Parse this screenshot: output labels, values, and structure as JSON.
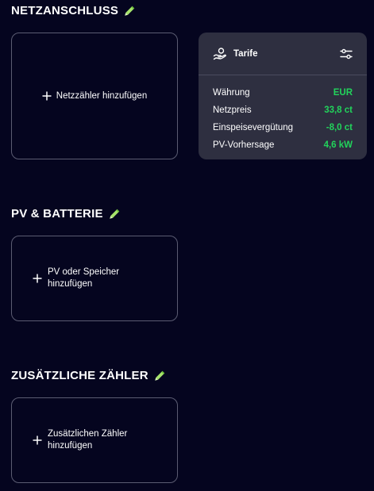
{
  "sections": {
    "grid": {
      "title": "NETZANSCHLUSS",
      "add_label": "Netzzähler hinzufügen",
      "edit_icon": "pencil-icon"
    },
    "pv": {
      "title": "PV & BATTERIE",
      "add_label": "PV oder Speicher hinzufügen",
      "edit_icon": "pencil-icon"
    },
    "meters": {
      "title": "ZUSÄTZLICHE ZÄHLER",
      "add_label": "Zusätzlichen Zähler hinzufügen",
      "edit_icon": "pencil-icon"
    }
  },
  "tariffs": {
    "title": "Tarife",
    "header_icon": "hand-coin-icon",
    "settings_icon": "sliders-icon",
    "rows": [
      {
        "label": "Währung",
        "value": "EUR"
      },
      {
        "label": "Netzpreis",
        "value": "33,8 ct"
      },
      {
        "label": "Einspeisevergütung",
        "value": "-8,0 ct"
      },
      {
        "label": "PV-Vorhersage",
        "value": "4,6 kW"
      }
    ]
  },
  "colors": {
    "background": "#05051f",
    "panel": "#2e2f40",
    "border": "#5b5c72",
    "accent_green": "#22d35b",
    "pencil": "#a6e36b"
  }
}
